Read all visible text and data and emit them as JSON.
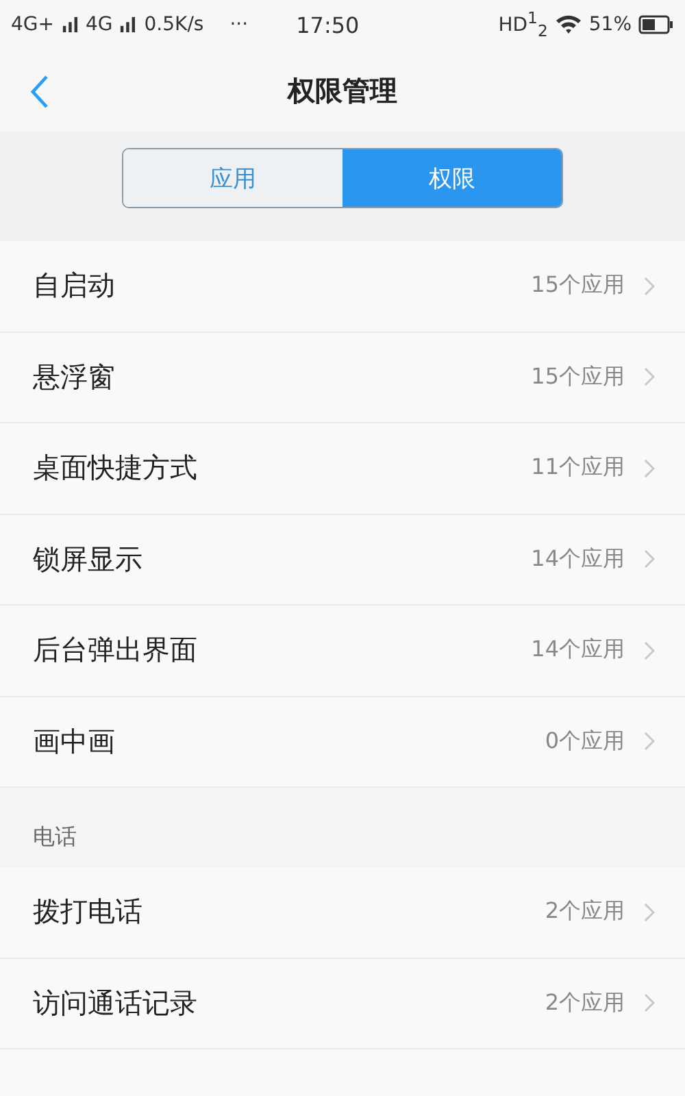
{
  "status_bar": {
    "network_1": "4G+",
    "network_2": "4G",
    "speed": "0.5K/s",
    "more": "···",
    "time": "17:50",
    "hd": "HD$^{1}$$_{2}$",
    "battery": "51%"
  },
  "header": {
    "title": "权限管理"
  },
  "tabs": [
    {
      "label": "应用",
      "selected": false
    },
    {
      "label": "权限",
      "selected": true
    }
  ],
  "sections": [
    {
      "rows": [
        {
          "label": "自启动",
          "count": "15个应用"
        },
        {
          "label": "悬浮窗",
          "count": "15个应用"
        },
        {
          "label": "桌面快捷方式",
          "count": "11个应用"
        },
        {
          "label": "锁屏显示",
          "count": "14个应用"
        },
        {
          "label": "后台弹出界面",
          "count": "14个应用"
        },
        {
          "label": "画中画",
          "count": "0个应用"
        }
      ]
    },
    {
      "title": "电话",
      "rows": [
        {
          "label": "拨打电话",
          "count": "2个应用"
        },
        {
          "label": "访问通话记录",
          "count": "2个应用"
        }
      ]
    }
  ]
}
